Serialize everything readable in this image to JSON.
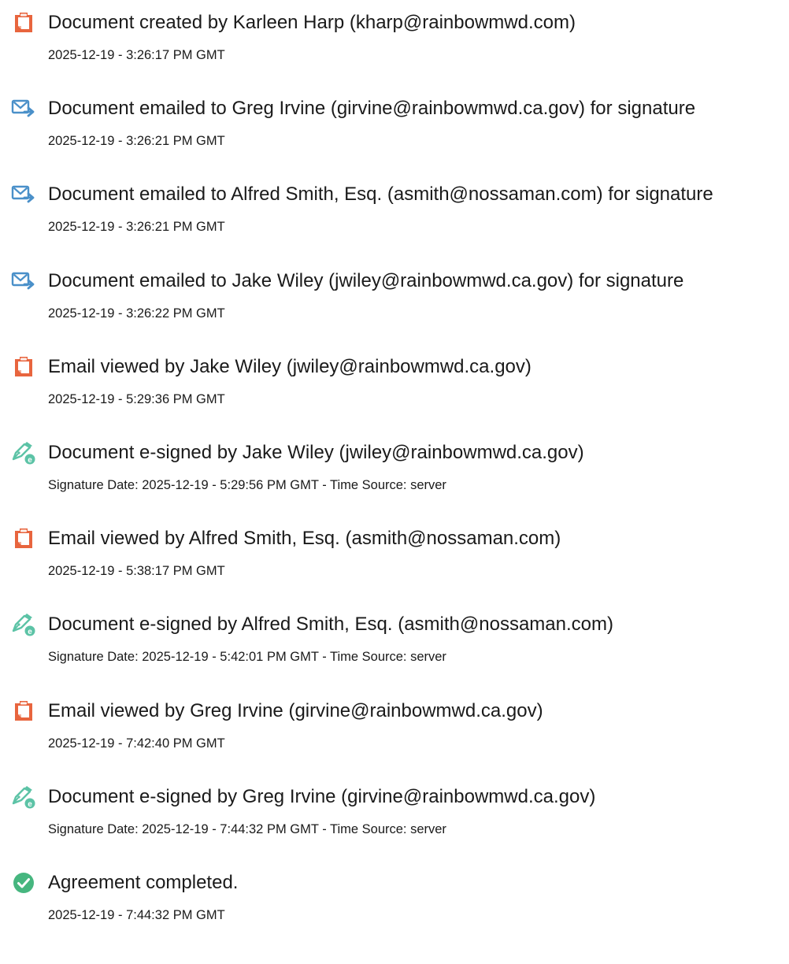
{
  "events": [
    {
      "icon": "document-icon",
      "text": "Document created by Karleen Harp (kharp@rainbowmwd.com)",
      "time": "2025-12-19 - 3:26:17 PM GMT"
    },
    {
      "icon": "email-sent-icon",
      "text": "Document emailed to Greg Irvine (girvine@rainbowmwd.ca.gov) for signature",
      "time": "2025-12-19 - 3:26:21 PM GMT"
    },
    {
      "icon": "email-sent-icon",
      "text": "Document emailed to Alfred Smith, Esq. (asmith@nossaman.com) for signature",
      "time": "2025-12-19 - 3:26:21 PM GMT"
    },
    {
      "icon": "email-sent-icon",
      "text": "Document emailed to Jake Wiley (jwiley@rainbowmwd.ca.gov) for signature",
      "time": "2025-12-19 - 3:26:22 PM GMT"
    },
    {
      "icon": "document-icon",
      "text": "Email viewed by Jake Wiley (jwiley@rainbowmwd.ca.gov)",
      "time": "2025-12-19 - 5:29:36 PM GMT"
    },
    {
      "icon": "e-sign-icon",
      "text": "Document e-signed by Jake Wiley (jwiley@rainbowmwd.ca.gov)",
      "time": "Signature Date: 2025-12-19 - 5:29:56 PM GMT - Time Source: server"
    },
    {
      "icon": "document-icon",
      "text": "Email viewed by Alfred Smith, Esq. (asmith@nossaman.com)",
      "time": "2025-12-19 - 5:38:17 PM GMT"
    },
    {
      "icon": "e-sign-icon",
      "text": "Document e-signed by Alfred Smith, Esq. (asmith@nossaman.com)",
      "time": "Signature Date: 2025-12-19 - 5:42:01 PM GMT - Time Source: server"
    },
    {
      "icon": "document-icon",
      "text": "Email viewed by Greg Irvine (girvine@rainbowmwd.ca.gov)",
      "time": "2025-12-19 - 7:42:40 PM GMT"
    },
    {
      "icon": "e-sign-icon",
      "text": "Document e-signed by Greg Irvine (girvine@rainbowmwd.ca.gov)",
      "time": "Signature Date: 2025-12-19 - 7:44:32 PM GMT - Time Source: server"
    },
    {
      "icon": "check-circle-icon",
      "text": "Agreement completed.",
      "time": "2025-12-19 - 7:44:32 PM GMT"
    }
  ],
  "colors": {
    "document": "#e8653e",
    "email": "#4a90c9",
    "sign": "#5cc3a6",
    "complete": "#46b67f"
  }
}
